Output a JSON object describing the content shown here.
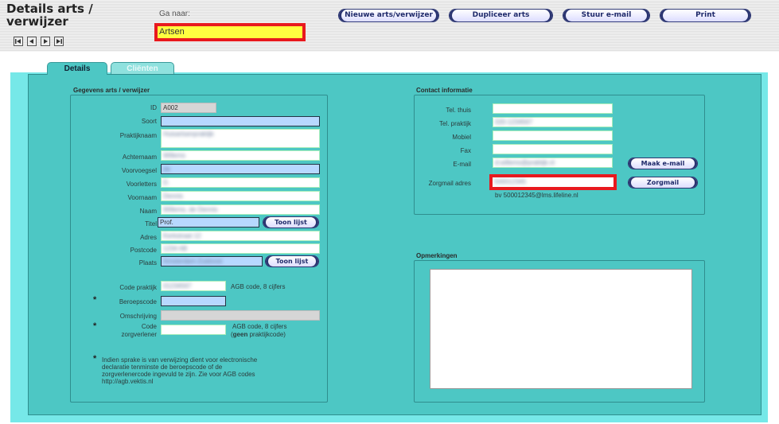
{
  "header": {
    "title_line1": "Details arts /",
    "title_line2": "verwijzer",
    "goto_label": "Ga naar:",
    "goto_value": "Artsen",
    "buttons": {
      "new_doctor": "Nieuwe arts/verwijzer",
      "duplicate": "Dupliceer arts",
      "send_email": "Stuur e-mail",
      "print": "Print"
    }
  },
  "tabs": {
    "details": "Details",
    "clients": "Cliënten"
  },
  "doctor": {
    "legend": "Gegevens arts / verwijzer",
    "labels": {
      "id": "ID",
      "soort": "Soort",
      "praktijknaam": "Praktijknaam",
      "achternaam": "Achternaam",
      "voorvoegsel": "Voorvoegsel",
      "voorletters": "Voorletters",
      "voornaam": "Voornaam",
      "naam": "Naam",
      "titel": "Titel",
      "adres": "Adres",
      "postcode": "Postcode",
      "plaats": "Plaats",
      "code_praktijk": "Code praktijk",
      "beroepscode": "Beroepscode",
      "omschrijving": "Omschrijving",
      "code_zorgverlener_1": "Code",
      "code_zorgverlener_2": "zorgverlener"
    },
    "values": {
      "id": "A002",
      "soort": "",
      "praktijknaam": "Huisartsenpraktijk",
      "achternaam": "Willems",
      "voorvoegsel": "de",
      "voorletters": "D.",
      "voornaam": "Dennis",
      "naam": "Willems, de Dennis",
      "titel": "Prof.",
      "adres": "Kerkstraat 12",
      "postcode": "1234 AB",
      "plaats": "Amsterdam-Zuidoost",
      "code_praktijk": "01234567",
      "beroepscode": "",
      "omschrijving": "",
      "code_zorgverlener": ""
    },
    "toon_lijst": "Toon lijst",
    "agb_hint": "AGB code, 8 cijfers",
    "agb_hint_2": "AGB code, 8 cijfers",
    "agb_geen_bold": "geen",
    "agb_geen_rest": "praktijkcode)",
    "agb_geen_open": "(",
    "note_star": "*",
    "note": [
      "Indien sprake is van verwijzing dient voor electronische",
      "declaratie tenminste de beroepscode of de",
      "zorgverlenercode ingevuld te zijn. Zie voor AGB codes",
      "http://agb.vektis.nl"
    ]
  },
  "contact": {
    "legend": "Contact informatie",
    "labels": {
      "tel_thuis": "Tel. thuis",
      "tel_praktijk": "Tel. praktijk",
      "mobiel": "Mobiel",
      "fax": "Fax",
      "email": "E-mail",
      "zorgmail": "Zorgmail adres"
    },
    "values": {
      "tel_thuis": "",
      "tel_praktijk": "020-1234567",
      "mobiel": "",
      "fax": "",
      "email": "d.willems@praktijk.nl",
      "zorgmail": "500012345"
    },
    "maak_email": "Maak e-mail",
    "zorgmail_button": "Zorgmail",
    "zorgmail_hint": "bv 500012345@lms.lifeline.nl"
  },
  "remarks": {
    "legend": "Opmerkingen",
    "value": ""
  },
  "colors": {
    "accent_red": "#e8191e",
    "panel": "#4dc7c4",
    "background": "#76e8e8"
  },
  "icons": {
    "nav": [
      "first-record-icon",
      "previous-record-icon",
      "next-record-icon",
      "last-record-icon"
    ]
  }
}
